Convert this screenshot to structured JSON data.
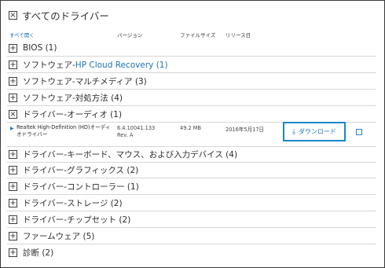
{
  "header": {
    "toggle_icon": "×",
    "title": "すべてのドライバー"
  },
  "columns": {
    "expand_all": "すべて開く",
    "version": "バージョン",
    "file_size": "ファイルサイズ",
    "release_date": "リリース日"
  },
  "categories": [
    {
      "icon": "+",
      "prefix": "BIOS (1)",
      "highlight": ""
    },
    {
      "icon": "+",
      "prefix": "ソフトウェア-",
      "highlight": "HP Cloud Recovery (1)"
    },
    {
      "icon": "+",
      "prefix": "ソフトウェア-マルチメディア (3)",
      "highlight": ""
    },
    {
      "icon": "+",
      "prefix": "ソフトウェア-対処方法 (4)",
      "highlight": ""
    },
    {
      "icon": "×",
      "prefix": "ドライバー-オーディオ (1)",
      "highlight": ""
    },
    {
      "icon": "+",
      "prefix": "ドライバー-キーボード、マウス、および入力デバイス (4)",
      "highlight": ""
    },
    {
      "icon": "+",
      "prefix": "ドライバー-グラフィックス (2)",
      "highlight": ""
    },
    {
      "icon": "+",
      "prefix": "ドライバー-コントローラー (1)",
      "highlight": ""
    },
    {
      "icon": "+",
      "prefix": "ドライバー-ストレージ (2)",
      "highlight": ""
    },
    {
      "icon": "+",
      "prefix": "ドライバー-チップセット (2)",
      "highlight": ""
    },
    {
      "icon": "+",
      "prefix": "ファームウェア (5)",
      "highlight": ""
    },
    {
      "icon": "+",
      "prefix": "診断 (2)",
      "highlight": ""
    }
  ],
  "driver": {
    "expand_icon": "▶",
    "name": "Realtek High-Definition (HD)オーディオドライバー",
    "version": "6.4.10041.133 Rev. A",
    "size": "49.2 MB",
    "date": "2016年5月17日",
    "download_icon": "⤓",
    "download_label": "ダウンロード"
  },
  "colors": {
    "link": "#1d72b3",
    "download_border": "#1a86cc"
  }
}
